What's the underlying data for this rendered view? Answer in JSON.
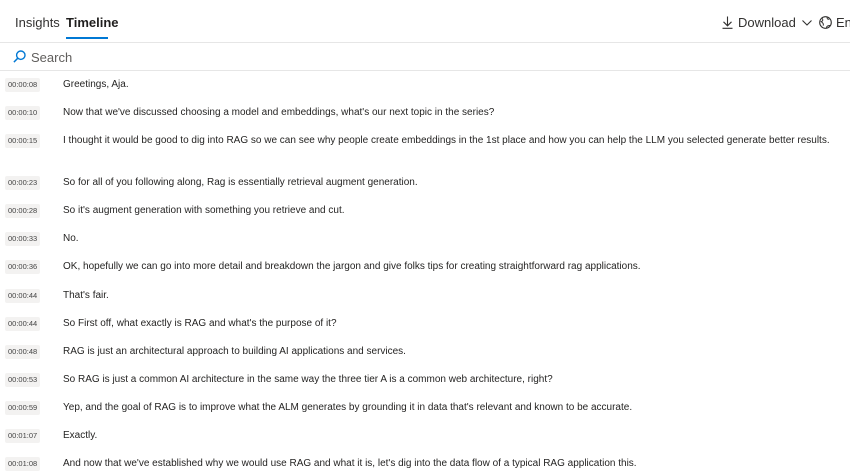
{
  "tabs": [
    {
      "label": "Insights"
    },
    {
      "label": "Timeline",
      "active": true
    }
  ],
  "toolbar": {
    "download_label": "Download",
    "language_label": "English",
    "download_icon": "download-arrow-icon",
    "language_icon": "globe-icon"
  },
  "search": {
    "placeholder": "Search",
    "icon": "search-icon"
  },
  "accent_color": "#0078d4",
  "transcript": [
    {
      "time": "00:00:08",
      "text": "Greetings, Aja."
    },
    {
      "time": "00:00:10",
      "text": "Now that we've discussed choosing a model and embeddings, what's our next topic in the series?"
    },
    {
      "time": "00:00:15",
      "text": "I thought it would be good to dig into RAG so we can see why people create embeddings in the 1st place and how you can help the LLM you selected generate better results."
    },
    {
      "time": "00:00:23",
      "text": "So for all of you following along, Rag is essentially retrieval augment generation."
    },
    {
      "time": "00:00:28",
      "text": "So it's augment generation with something you retrieve and cut."
    },
    {
      "time": "00:00:33",
      "text": "No."
    },
    {
      "time": "00:00:36",
      "text": "OK, hopefully we can go into more detail and breakdown the jargon and give folks tips for creating straightforward rag applications."
    },
    {
      "time": "00:00:44",
      "text": "That's fair."
    },
    {
      "time": "00:00:44",
      "text": "So First off, what exactly is RAG and what's the purpose of it?"
    },
    {
      "time": "00:00:48",
      "text": "RAG is just an architectural approach to building AI applications and services."
    },
    {
      "time": "00:00:53",
      "text": "So RAG is just a common AI architecture in the same way the three tier A is a common web architecture, right?"
    },
    {
      "time": "00:00:59",
      "text": "Yep, and the goal of RAG is to improve what the ALM generates by grounding it in data that's relevant and known to be accurate."
    },
    {
      "time": "00:01:07",
      "text": "Exactly."
    },
    {
      "time": "00:01:08",
      "text": "And now that we've established why we would use RAG and what it is, let's dig into the data flow of a typical RAG application this."
    }
  ]
}
